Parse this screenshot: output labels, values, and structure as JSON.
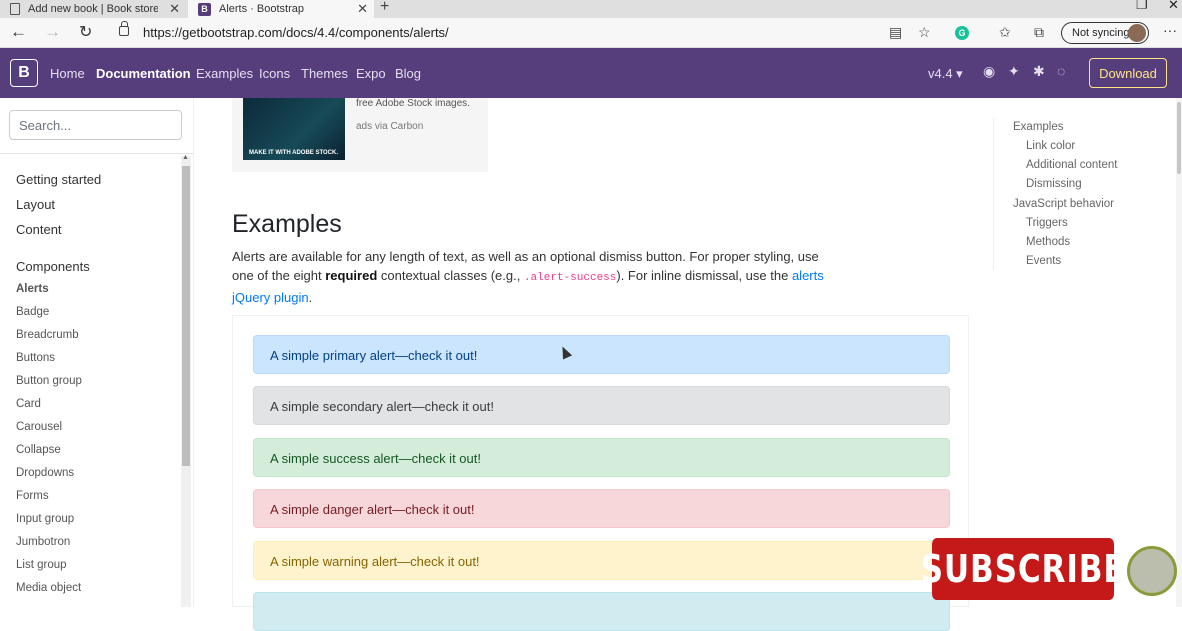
{
  "browser": {
    "tabs": [
      {
        "title": "Add new book | Book store appl",
        "close": "✕"
      },
      {
        "title": "Alerts · Bootstrap",
        "close": "✕"
      }
    ],
    "new_tab": "+",
    "url": "https://getbootstrap.com/docs/4.4/components/alerts/",
    "profile_label": "Not syncing",
    "grammarly_letter": "G",
    "more_glyph": "···"
  },
  "navbar": {
    "brand": "B",
    "links": [
      "Home",
      "Documentation",
      "Examples",
      "Icons",
      "Themes",
      "Expo",
      "Blog"
    ],
    "active_link": "Documentation",
    "version": "v4.4 ▾",
    "download_label": "Download"
  },
  "sidebar": {
    "search_placeholder": "Search...",
    "groups": [
      "Getting started",
      "Layout",
      "Content",
      "Components"
    ],
    "active_item": "Alerts",
    "items": [
      "Badge",
      "Breadcrumb",
      "Buttons",
      "Button group",
      "Card",
      "Carousel",
      "Collapse",
      "Dropdowns",
      "Forms",
      "Input group",
      "Jumbotron",
      "List group",
      "Media object"
    ]
  },
  "ad": {
    "text": "free Adobe Stock images.",
    "via": "ads via Carbon",
    "image_cta": "MAKE IT WITH ADOBE STOCK."
  },
  "main": {
    "heading": "Examples",
    "lead_part1": "Alerts are available for any length of text, as well as an optional dismiss button. For proper styling, use one of the eight ",
    "lead_bold": "required",
    "lead_part2": " contextual classes (e.g., ",
    "lead_code": ".alert-success",
    "lead_part3": "). For inline dismissal, use the ",
    "lead_link": "alerts jQuery plugin",
    "lead_end": ".",
    "alerts": [
      "A simple primary alert—check it out!",
      "A simple secondary alert—check it out!",
      "A simple success alert—check it out!",
      "A simple danger alert—check it out!",
      "A simple warning alert—check it out!"
    ]
  },
  "toc": {
    "items": [
      "Examples",
      "Link color",
      "Additional content",
      "Dismissing",
      "JavaScript behavior",
      "Triggers",
      "Methods",
      "Events"
    ]
  },
  "overlay": {
    "subscribe": "SUBSCRIBE"
  }
}
